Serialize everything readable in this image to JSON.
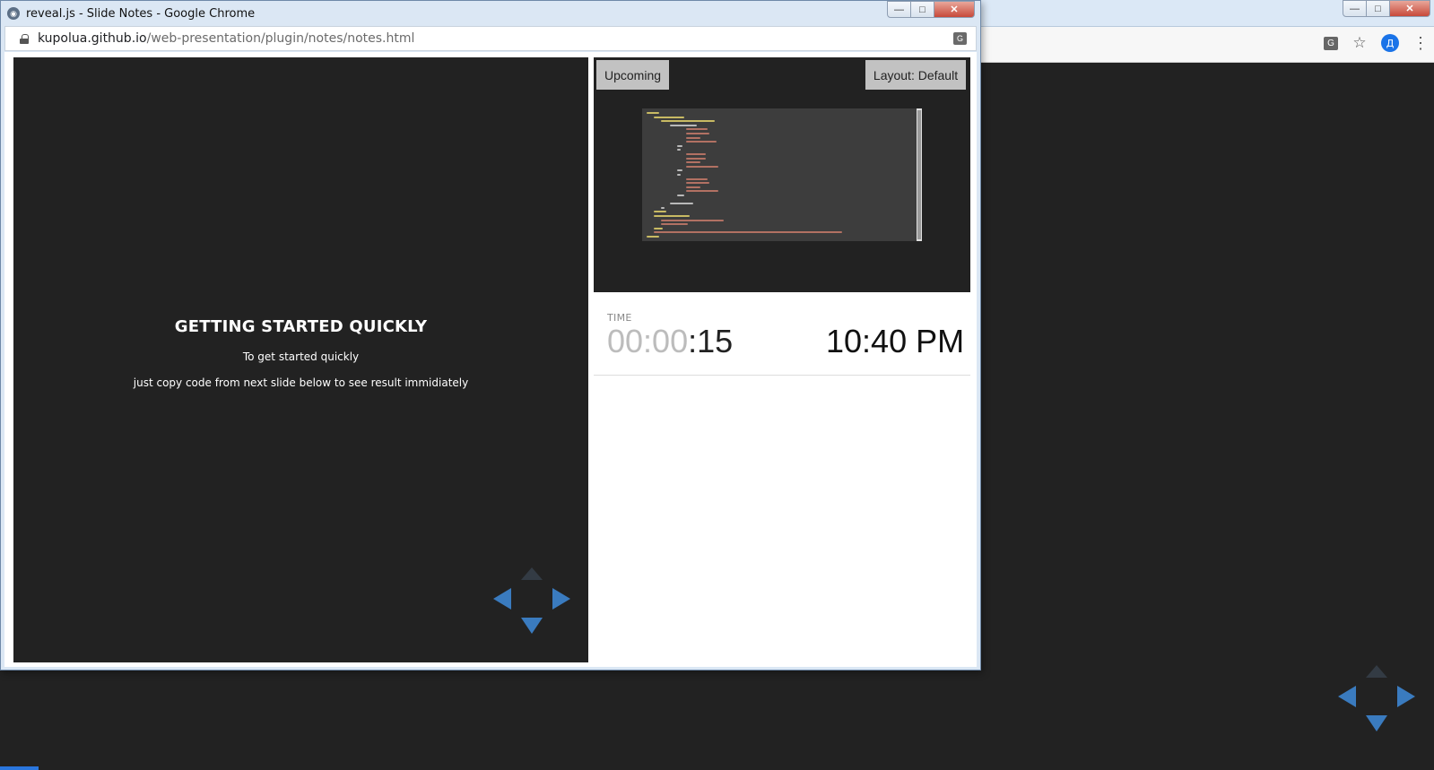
{
  "background_window": {
    "right_icons": [
      "translate-icon",
      "star-icon",
      "profile-avatar",
      "menu-icon"
    ],
    "avatar_letter": "Д",
    "star_glyph": "☆",
    "menu_glyph": "⋮",
    "translate_glyph": "G"
  },
  "popup": {
    "title": "reveal.js - Slide Notes - Google Chrome",
    "url_host": "kupolua.github.io",
    "url_path": "/web-presentation/plugin/notes/notes.html",
    "window_buttons": {
      "minimize": "—",
      "maximize": "□",
      "close": "✕"
    }
  },
  "current_slide": {
    "title": "GETTING STARTED QUICKLY",
    "lines": [
      "To get started quickly",
      "just copy code from next slide below to see result immidiately"
    ]
  },
  "upcoming": {
    "label": "Upcoming",
    "layout_button": "Layout: Default"
  },
  "timer": {
    "label": "TIME",
    "hours_minutes_dim": "00:00",
    "seconds": ":15",
    "clock": "10:40 PM"
  },
  "colors": {
    "slide_bg": "#222222",
    "nav_arrow": "#3a7bbf",
    "nav_arrow_disabled": "#333b44",
    "progress": "#2a76dd"
  }
}
